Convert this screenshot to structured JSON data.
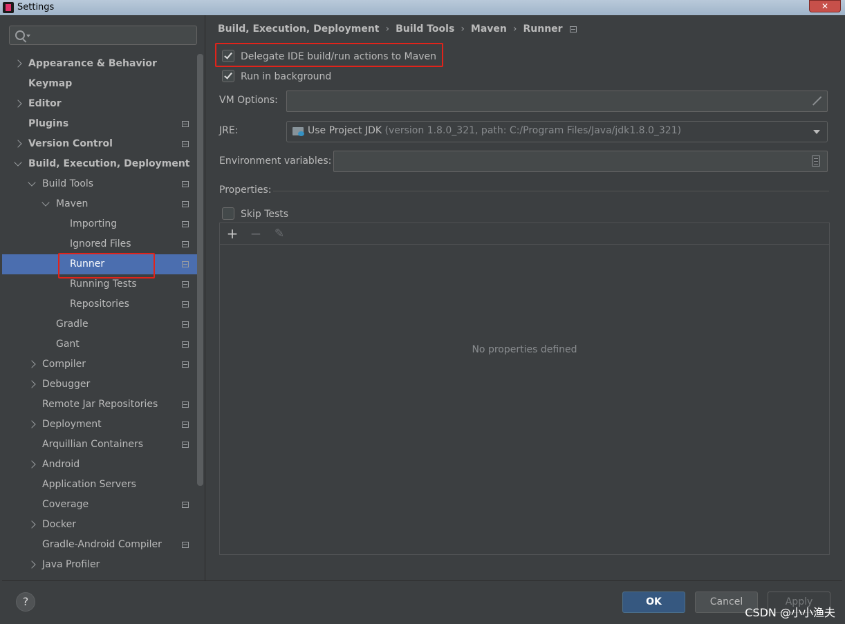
{
  "window": {
    "title": "Settings",
    "close_glyph": "✕"
  },
  "sidebar": {
    "search": {
      "placeholder": "",
      "icon": "search-icon"
    },
    "items": [
      {
        "label": "Appearance & Behavior",
        "chevron": "right",
        "bold": true,
        "level": 0,
        "settings_icon": false
      },
      {
        "label": "Keymap",
        "chevron": "none",
        "bold": true,
        "level": 0,
        "settings_icon": false
      },
      {
        "label": "Editor",
        "chevron": "right",
        "bold": true,
        "level": 0,
        "settings_icon": false
      },
      {
        "label": "Plugins",
        "chevron": "none",
        "bold": true,
        "level": 0,
        "settings_icon": true
      },
      {
        "label": "Version Control",
        "chevron": "right",
        "bold": true,
        "level": 0,
        "settings_icon": true
      },
      {
        "label": "Build, Execution, Deployment",
        "chevron": "down",
        "bold": true,
        "level": 0,
        "settings_icon": false
      },
      {
        "label": "Build Tools",
        "chevron": "down",
        "bold": false,
        "level": 1,
        "settings_icon": true
      },
      {
        "label": "Maven",
        "chevron": "down",
        "bold": false,
        "level": 2,
        "settings_icon": true
      },
      {
        "label": "Importing",
        "chevron": "none",
        "bold": false,
        "level": 3,
        "settings_icon": true
      },
      {
        "label": "Ignored Files",
        "chevron": "none",
        "bold": false,
        "level": 3,
        "settings_icon": true
      },
      {
        "label": "Runner",
        "chevron": "none",
        "bold": false,
        "level": 3,
        "settings_icon": true,
        "selected": true
      },
      {
        "label": "Running Tests",
        "chevron": "none",
        "bold": false,
        "level": 3,
        "settings_icon": true
      },
      {
        "label": "Repositories",
        "chevron": "none",
        "bold": false,
        "level": 3,
        "settings_icon": true
      },
      {
        "label": "Gradle",
        "chevron": "none",
        "bold": false,
        "level": 2,
        "settings_icon": true
      },
      {
        "label": "Gant",
        "chevron": "none",
        "bold": false,
        "level": 2,
        "settings_icon": true
      },
      {
        "label": "Compiler",
        "chevron": "right",
        "bold": false,
        "level": 1,
        "settings_icon": true
      },
      {
        "label": "Debugger",
        "chevron": "right",
        "bold": false,
        "level": 1,
        "settings_icon": false
      },
      {
        "label": "Remote Jar Repositories",
        "chevron": "none",
        "bold": false,
        "level": 1,
        "settings_icon": true
      },
      {
        "label": "Deployment",
        "chevron": "right",
        "bold": false,
        "level": 1,
        "settings_icon": true
      },
      {
        "label": "Arquillian Containers",
        "chevron": "none",
        "bold": false,
        "level": 1,
        "settings_icon": true
      },
      {
        "label": "Android",
        "chevron": "right",
        "bold": false,
        "level": 1,
        "settings_icon": false
      },
      {
        "label": "Application Servers",
        "chevron": "none",
        "bold": false,
        "level": 1,
        "settings_icon": false
      },
      {
        "label": "Coverage",
        "chevron": "none",
        "bold": false,
        "level": 1,
        "settings_icon": true
      },
      {
        "label": "Docker",
        "chevron": "right",
        "bold": false,
        "level": 1,
        "settings_icon": false
      },
      {
        "label": "Gradle-Android Compiler",
        "chevron": "none",
        "bold": false,
        "level": 1,
        "settings_icon": true
      },
      {
        "label": "Java Profiler",
        "chevron": "right",
        "bold": false,
        "level": 1,
        "settings_icon": false
      }
    ]
  },
  "main": {
    "breadcrumb": [
      "Build, Execution, Deployment",
      "Build Tools",
      "Maven",
      "Runner"
    ],
    "breadcrumb_sep": "›",
    "delegate_checkbox": {
      "label": "Delegate IDE build/run actions to Maven",
      "checked": true
    },
    "background_checkbox": {
      "label": "Run in background",
      "checked": true
    },
    "vm_options": {
      "label": "VM Options:",
      "value": ""
    },
    "jre": {
      "label": "JRE:",
      "value": "Use Project JDK",
      "detail": "(version 1.8.0_321, path: C:/Program Files/Java/jdk1.8.0_321)"
    },
    "env_vars": {
      "label": "Environment variables:",
      "value": ""
    },
    "properties": {
      "label": "Properties:",
      "skip_tests": {
        "label": "Skip Tests",
        "checked": false
      },
      "toolbar": {
        "add": "+",
        "remove": "−",
        "edit": "✎"
      },
      "empty_text": "No properties defined"
    }
  },
  "footer": {
    "help": "?",
    "ok": "OK",
    "cancel": "Cancel",
    "apply": "Apply"
  },
  "watermark": "CSDN @小小渔夫",
  "colors": {
    "highlight_box": "#e2231a",
    "selection": "#4b6eaf",
    "ok_button": "#365880"
  }
}
